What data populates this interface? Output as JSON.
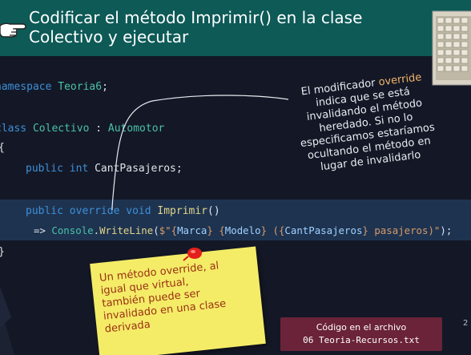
{
  "slide": {
    "title_line1": "Codificar el método Imprimir() en la clase",
    "title_line2": "Colectivo y ejecutar"
  },
  "code": {
    "line1": {
      "namespace_kw": "namespace",
      "ns_name": "Teoria6",
      "semi": ";"
    },
    "line2": {
      "class_kw": "class",
      "class_name": "Colectivo",
      "colon": ":",
      "base_name": "Automotor"
    },
    "line3": {
      "brace": "{"
    },
    "line4": {
      "public_kw": "public",
      "int_kw": "int",
      "prop": "CantPasajeros",
      "semi": ";"
    },
    "line5": {
      "public_kw": "public",
      "override_kw": "override",
      "void_kw": "void",
      "method": "Imprimir",
      "parens": "()"
    },
    "line6": {
      "arrow": "=>",
      "console": "Console",
      "dot": ".",
      "writeline": "WriteLine",
      "open_paren": "(",
      "dollar": "$\"",
      "interp1_open": "{",
      "interp1": "Marca",
      "interp1_close": "}",
      "space1": " ",
      "interp2_open": "{",
      "interp2": "Modelo",
      "interp2_close": "}",
      "text1": " (",
      "interp3_open": "{",
      "interp3": "CantPasajeros",
      "interp3_close": "}",
      "text2": " pasajeros)\"",
      "close": ");"
    },
    "line7": {
      "brace": "}"
    }
  },
  "annotation": {
    "line1_prefix": "El modificador ",
    "line1_accent": "override",
    "line2": "indica que se está",
    "line3": "invalidando el método",
    "line4": "heredado. Si no lo",
    "line5": "especificamos  estaríamos",
    "line6": "ocultando el método en",
    "line7": "lugar de invalidarlo"
  },
  "sticky": {
    "line1": "Un método override, al",
    "line2": "igual que virtual,",
    "line3": "también puede ser",
    "line4": "invalidado en una clase",
    "line5": "derivada"
  },
  "filebox": {
    "caption": "Código en el archivo",
    "filename": "06 Teoria-Recursos.txt"
  },
  "page_number": "2",
  "colors": {
    "header_bg": "#0d5a57",
    "slide_bg": "#141826",
    "highlight_bg": "#1e3350",
    "sticky_bg": "#f4ec67",
    "sticky_text": "#9b2f14",
    "filebox_bg": "#6a2339",
    "accent": "#f2b46a"
  },
  "icons": {
    "header_hand": "pointing-hand-icon",
    "header_keyboard": "keyboard-icon",
    "sticky_pin": "pushpin-icon"
  }
}
